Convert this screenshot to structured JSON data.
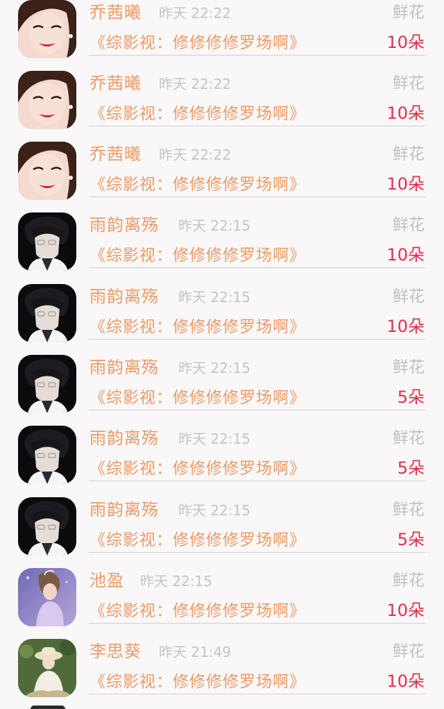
{
  "gifts": [
    {
      "sender": "乔茜曦",
      "time": "昨天 22:22",
      "gift_label": "鲜花",
      "book": "《综影视：修修修修罗场啊》",
      "count": "10朵",
      "avatar": "girl-red-lips"
    },
    {
      "sender": "乔茜曦",
      "time": "昨天 22:22",
      "gift_label": "鲜花",
      "book": "《综影视：修修修修罗场啊》",
      "count": "10朵",
      "avatar": "girl-red-lips"
    },
    {
      "sender": "乔茜曦",
      "time": "昨天 22:22",
      "gift_label": "鲜花",
      "book": "《综影视：修修修修罗场啊》",
      "count": "10朵",
      "avatar": "girl-red-lips"
    },
    {
      "sender": "雨韵离殇",
      "time": "昨天 22:15",
      "gift_label": "鲜花",
      "book": "《综影视：修修修修罗场啊》",
      "count": "10朵",
      "avatar": "boy-dark-hair"
    },
    {
      "sender": "雨韵离殇",
      "time": "昨天 22:15",
      "gift_label": "鲜花",
      "book": "《综影视：修修修修罗场啊》",
      "count": "10朵",
      "avatar": "boy-dark-hair"
    },
    {
      "sender": "雨韵离殇",
      "time": "昨天 22:15",
      "gift_label": "鲜花",
      "book": "《综影视：修修修修罗场啊》",
      "count": "5朵",
      "avatar": "boy-dark-hair"
    },
    {
      "sender": "雨韵离殇",
      "time": "昨天 22:15",
      "gift_label": "鲜花",
      "book": "《综影视：修修修修罗场啊》",
      "count": "5朵",
      "avatar": "boy-dark-hair"
    },
    {
      "sender": "雨韵离殇",
      "time": "昨天 22:15",
      "gift_label": "鲜花",
      "book": "《综影视：修修修修罗场啊》",
      "count": "5朵",
      "avatar": "boy-dark-hair"
    },
    {
      "sender": "池盈",
      "time": "昨天 22:15",
      "gift_label": "鲜花",
      "book": "《综影视：修修修修罗场啊》",
      "count": "10朵",
      "avatar": "girl-purple-fantasy"
    },
    {
      "sender": "李思葵",
      "time": "昨天 21:49",
      "gift_label": "鲜花",
      "book": "《综影视：修修修修罗场啊》",
      "count": "10朵",
      "avatar": "girl-straw-hat"
    }
  ],
  "colors": {
    "background": "#f9f7f8",
    "name": "#ec9b66",
    "time": "#c4c4c4",
    "gift_label": "#bfbfbf",
    "count": "#e0314b",
    "divider": "#cfcfcf"
  }
}
